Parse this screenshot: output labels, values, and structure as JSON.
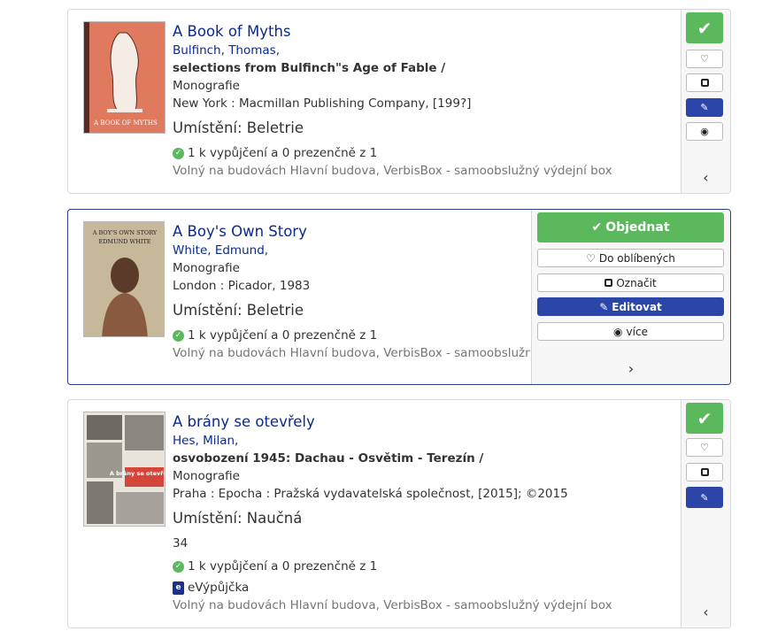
{
  "icons": {
    "check": "✔",
    "heart": "♡",
    "square": "□",
    "edit": "✎",
    "eye": "◉",
    "chevron_left": "‹",
    "chevron_right": "›",
    "avail_tick": "✓",
    "ebook": "e"
  },
  "colors": {
    "accent_green": "#5cb85c",
    "accent_blue": "#2c45a8",
    "link_blue": "#0b2a8f"
  },
  "records": [
    {
      "title": "A Book of Myths",
      "author": "Bulfinch, Thomas,",
      "subtitle": "selections from Bulfinch\"s Age of Fable /",
      "type": "Monografie",
      "publisher": "New York : Macmillan Publishing Company, [199?]",
      "location": "Umístění: Beletrie",
      "availability": "1 k vypůjčení a 0 prezenčně z 1",
      "free_at": "Volný na budovách Hlavní budova, VerbisBox - samoobslužný výdejní box",
      "cover_text": "A BOOK OF MYTHS"
    },
    {
      "title": "A Boy's Own Story",
      "author": "White, Edmund,",
      "type": "Monografie",
      "publisher": "London : Picador, 1983",
      "location": "Umístění: Beletrie",
      "availability": "1 k vypůjčení a 0 prezenčně z 1",
      "free_at": "Volný na budovách Hlavní budova, VerbisBox - samoobslužný výdejní box",
      "cover_text_1": "A BOY'S OWN STORY",
      "cover_text_2": "EDMUND WHITE",
      "actions": {
        "order": "Objednat",
        "favorite": "Do oblíbených",
        "mark": "Označit",
        "edit": "Editovat",
        "more": "více"
      }
    },
    {
      "title": "A brány se otevřely",
      "author": "Hes, Milan,",
      "subtitle": "osvobození 1945: Dachau - Osvětim - Terezín /",
      "type": "Monografie",
      "publisher": "Praha : Epocha : Pražská vydavatelská společnost, [2015]; ©2015",
      "location": "Umístění: Naučná",
      "extra": "34",
      "availability": "1 k vypůjčení a 0 prezenčně z 1",
      "ebook": "eVýpůjčka",
      "free_at": "Volný na budovách Hlavní budova, VerbisBox - samoobslužný výdejní box",
      "cover_text": "A brány se otevřely..."
    }
  ]
}
